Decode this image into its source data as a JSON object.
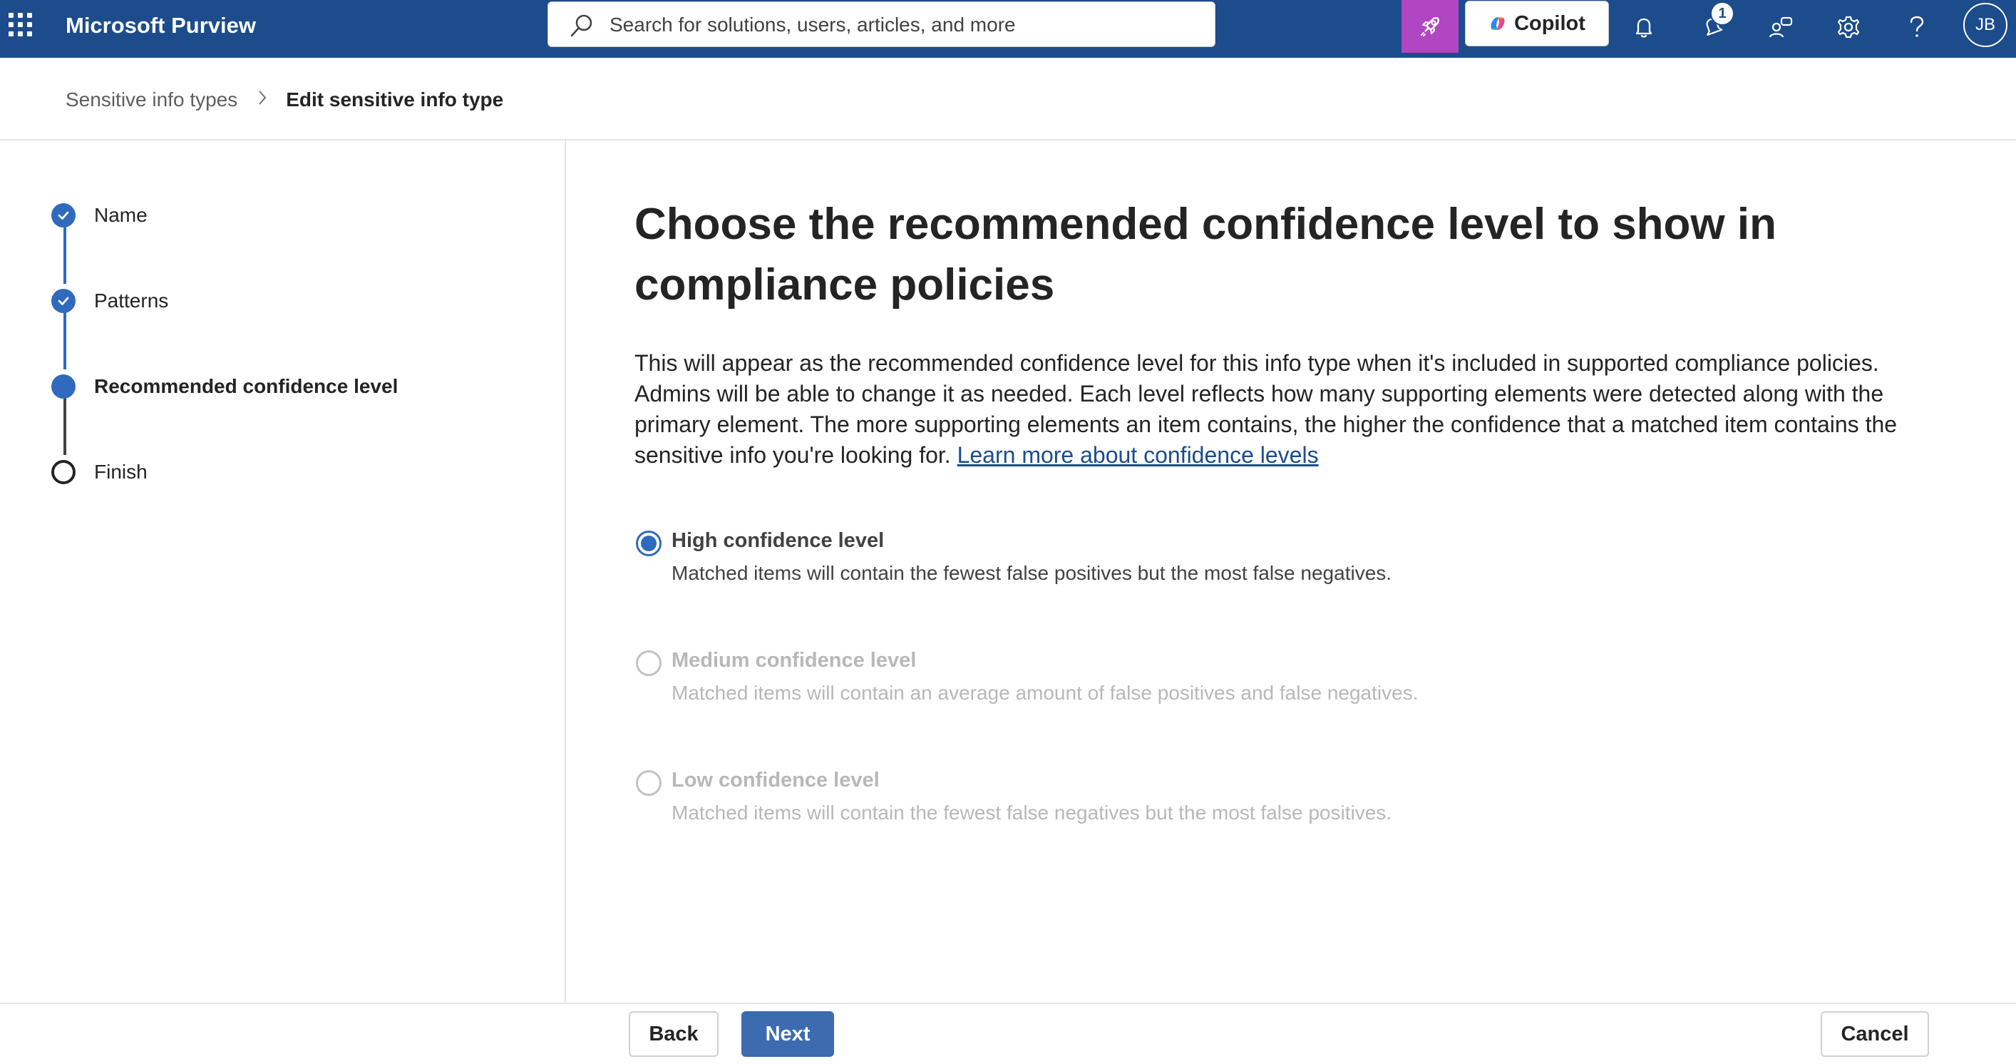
{
  "header": {
    "app_title": "Microsoft Purview",
    "search_placeholder": "Search for solutions, users, articles, and more",
    "copilot_label": "Copilot",
    "notification_badge": "1",
    "avatar_initials": "JB",
    "colors": {
      "bar": "#1c4c8c",
      "rocket_button": "#b146c2"
    },
    "icons": [
      "app-launcher-icon",
      "search-icon",
      "rocket-icon",
      "copilot-icon",
      "bell-icon",
      "activity-icon",
      "people-icon",
      "gear-icon",
      "help-icon"
    ]
  },
  "breadcrumb": {
    "parent": "Sensitive info types",
    "current": "Edit sensitive info type"
  },
  "steps": [
    {
      "label": "Name",
      "state": "done"
    },
    {
      "label": "Patterns",
      "state": "done"
    },
    {
      "label": "Recommended confidence level",
      "state": "current"
    },
    {
      "label": "Finish",
      "state": "todo"
    }
  ],
  "main": {
    "title": "Choose the recommended confidence level to show in compliance policies",
    "description": "This will appear as the recommended confidence level for this info type when it's included in supported compliance policies. Admins will be able to change it as needed. Each level reflects how many supporting elements were detected along with the primary element. The more supporting elements an item contains, the higher the confidence that a matched item contains the sensitive info you're looking for.",
    "learn_more": "Learn more about confidence levels",
    "options": [
      {
        "title": "High confidence level",
        "description": "Matched items will contain the fewest false positives but the most false negatives.",
        "selected": true,
        "disabled": false
      },
      {
        "title": "Medium confidence level",
        "description": "Matched items will contain an average amount of false positives and false negatives.",
        "selected": false,
        "disabled": true
      },
      {
        "title": "Low confidence level",
        "description": "Matched items will contain the fewest false negatives but the most false positives.",
        "selected": false,
        "disabled": true
      }
    ]
  },
  "footer": {
    "back_label": "Back",
    "next_label": "Next",
    "cancel_label": "Cancel"
  }
}
